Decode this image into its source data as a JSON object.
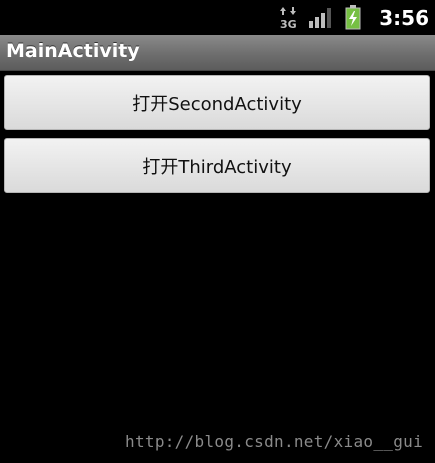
{
  "status_bar": {
    "network_icon": "3g-data-icon",
    "signal_icon": "signal-strength-icon",
    "battery_icon": "battery-charging-icon",
    "time": "3:56",
    "accent_color": "#76c043"
  },
  "title_bar": {
    "title": "MainActivity"
  },
  "buttons": {
    "open_second": "打开SecondActivity",
    "open_third": "打开ThirdActivity"
  },
  "watermark": {
    "text": "http://blog.csdn.net/xiao__gui"
  }
}
